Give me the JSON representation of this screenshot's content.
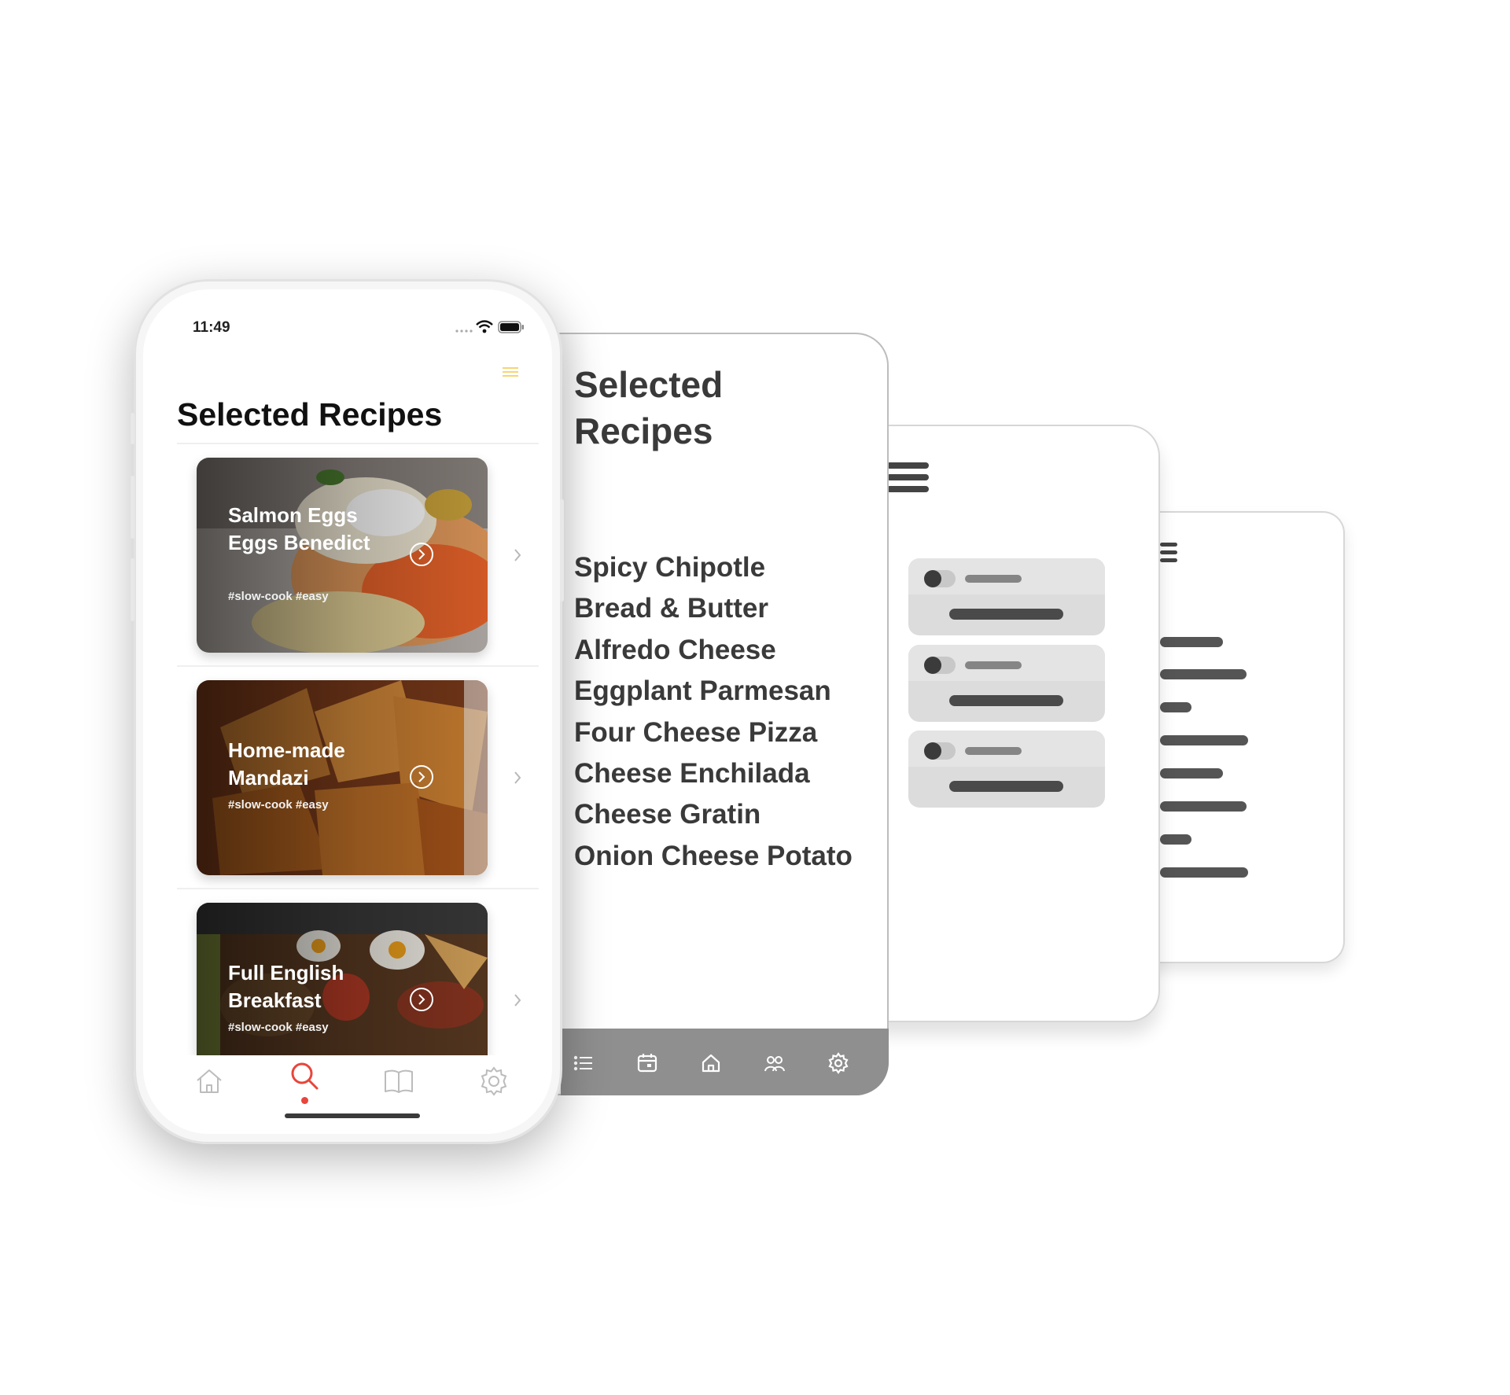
{
  "phone": {
    "status_time": "11:49",
    "page_title": "Selected Recipes",
    "recipes": [
      {
        "title": "Salmon Eggs Eggs Benedict",
        "tags": "#slow-cook #easy"
      },
      {
        "title": "Home-made Mandazi",
        "tags": "#slow-cook #easy"
      },
      {
        "title": "Full English Breakfast",
        "tags": "#slow-cook #easy"
      }
    ],
    "tab_icons": [
      "home-icon",
      "search-icon",
      "book-icon",
      "settings-icon"
    ],
    "accent_color": "#e8453c",
    "menu_color": "#f5c542"
  },
  "wireframe_list": {
    "title": "Selected Recipes",
    "items": [
      "Spicy Chipotle",
      "Bread & Butter",
      "Alfredo Cheese",
      "Eggplant Parmesan",
      "Four Cheese Pizza",
      "Cheese Enchilada",
      "Cheese Gratin",
      "Onion Cheese Potato"
    ],
    "tab_icons": [
      "list-icon",
      "calendar-icon",
      "home-icon",
      "people-icon",
      "settings-icon"
    ]
  }
}
